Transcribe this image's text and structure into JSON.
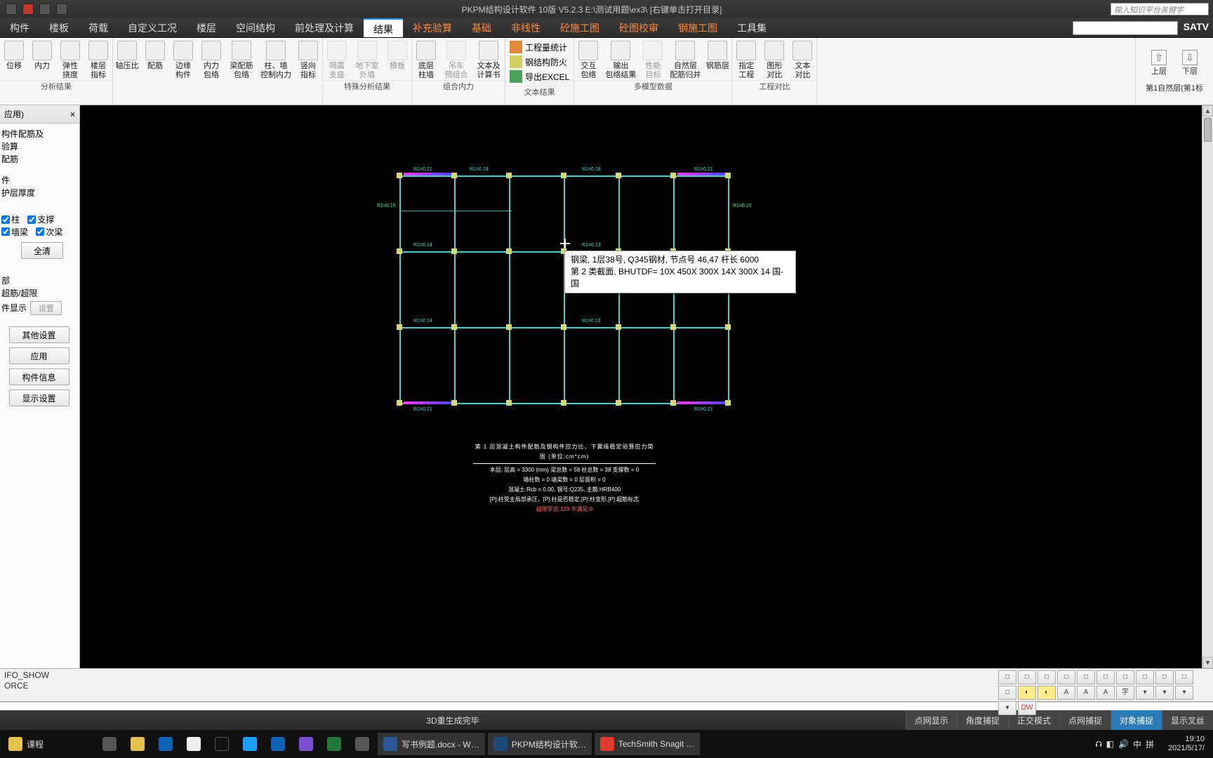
{
  "title": "PKPM结构设计软件 10版 V5.2.3 E:\\测试用题\\ex3\\   [右键单击打开目录]",
  "search_placeholder": "输入知识平台关键字",
  "menu": {
    "items": [
      "构件",
      "楼板",
      "荷载",
      "自定义工况",
      "楼层",
      "空间结构",
      "前处理及计算",
      "结果",
      "补充验算",
      "基础",
      "非线性",
      "砼施工图",
      "砼图校审",
      "钢施工图",
      "工具集"
    ],
    "active": 7,
    "dropdown": "",
    "satv": "SATV"
  },
  "ribbon": {
    "groups": [
      {
        "label": "分析结果",
        "btns": [
          {
            "l": "位移"
          },
          {
            "l": "内力"
          },
          {
            "l": "弹性\n挠度"
          },
          {
            "l": "楼层\n指标"
          }
        ]
      },
      {
        "label": "",
        "btns": [
          {
            "l": "轴压比"
          },
          {
            "l": "配筋"
          },
          {
            "l": "边缘\n构件"
          },
          {
            "l": "内力\n包络"
          },
          {
            "l": "梁配筋\n包络"
          },
          {
            "l": "柱、墙\n控制内力"
          },
          {
            "l": "竖向\n指标"
          }
        ]
      },
      {
        "label": "特殊分析结果",
        "btns": [
          {
            "l": "隔震\n支座",
            "d": true
          },
          {
            "l": "地下室\n外墙",
            "d": true
          },
          {
            "l": "模板",
            "d": true
          }
        ]
      },
      {
        "label": "组合内力",
        "btns": [
          {
            "l": "底层\n柱墙"
          },
          {
            "l": "吊车\n预组合",
            "d": true
          },
          {
            "l": "文本及\n计算书"
          }
        ]
      },
      {
        "label": "文本结果",
        "btns": [
          {
            "l": "工程量统计",
            "icon": "doc-icon"
          },
          {
            "l": "钢结构防火",
            "icon": "shield-icon"
          },
          {
            "l": "导出EXCEL",
            "icon": "export-icon"
          }
        ]
      },
      {
        "label": "多模型数据",
        "btns": [
          {
            "l": "交互\n包络"
          },
          {
            "l": "输出\n包络结果"
          },
          {
            "l": "性能\n目标",
            "d": true
          },
          {
            "l": "自然层\n配筋归并"
          },
          {
            "l": "钢筋层"
          }
        ]
      },
      {
        "label": "工程对比",
        "btns": [
          {
            "l": "指定\n工程"
          },
          {
            "l": "图形\n对比"
          },
          {
            "l": "文本\n对比"
          }
        ]
      }
    ],
    "floor": {
      "up": "上层",
      "down": "下层",
      "label": "第1自然层(第1标"
    }
  },
  "side": {
    "title": "应用)",
    "lines": [
      "构件配筋及",
      "验算",
      "配筋",
      "",
      "件",
      "护层厚度"
    ],
    "checks": [
      {
        "l": "柱",
        "c": true
      },
      {
        "l": "支撑",
        "c": true
      },
      {
        "l": "墙梁",
        "c": true
      },
      {
        "l": "次梁",
        "c": true
      }
    ],
    "btn_clear": "全清",
    "lines2": [
      "部",
      "超筋/超限"
    ],
    "lbl_disp": "件显示",
    "btn_set": "设置",
    "btn_other": "其他设置",
    "btn_apply": "应用",
    "btn_memberinfo": "构件信息",
    "btn_dispset": "显示设置"
  },
  "tooltip": {
    "l1": "钢梁, 1层38号, Q345钢材, 节点号 46,47 杆长 6000",
    "l2": "第 2 类截面, BHUTDF=   10X 450X 300X   14X 300X   14 国-国"
  },
  "drawing_notes": {
    "title": "第 1 层混凝土构件配筋及钢构件应力比、下翼缘稳定验算应力简图 (单位:cm*cm)",
    "n1": "本层: 层高 = 3300 (mm) 梁总数 = 58 柱总数 = 38  支撑数 = 0",
    "n2": "墙柱数 = 0   墙梁数 = 0   层面积 = 0",
    "n3": "混凝土:Rcb = 0.00, 钢号:Q235, 主筋:HRB400",
    "n4": "[P]:柱受主局部承压，[P]:柱是否稳定,[P]:柱变形,[P]:超筋标志",
    "warn": "超限学员:129   不满足:0"
  },
  "cmd": {
    "l1": "IFO_SHOW",
    "l2": "ORCE"
  },
  "toolbar3d": [
    "□",
    "□",
    "□",
    "□",
    "□",
    "□",
    "□",
    "□",
    "□",
    "□",
    "□",
    "◐",
    "◐",
    "A",
    "A",
    "A",
    "字",
    "▾",
    "▾",
    "▾",
    "▾",
    "DW"
  ],
  "status": {
    "center": "3D重生成完毕",
    "segs": [
      {
        "l": "点网显示"
      },
      {
        "l": "角度捕捉"
      },
      {
        "l": "正交模式"
      },
      {
        "l": "点网捕捉"
      },
      {
        "l": "对象捕捉",
        "a": true
      },
      {
        "l": "显示叉丝"
      }
    ]
  },
  "taskbar": {
    "start": "课程",
    "items": [
      {
        "l": "",
        "i": "#333"
      },
      {
        "l": "",
        "i": "#333"
      },
      {
        "l": "",
        "i": "#0a63b5"
      },
      {
        "l": "",
        "i": "#fff"
      },
      {
        "l": "",
        "i": "#111"
      },
      {
        "l": "",
        "i": "#1a9fff"
      },
      {
        "l": "",
        "i": "#0a63b5"
      },
      {
        "l": "",
        "i": "#7a4fd1"
      },
      {
        "l": "",
        "i": "#1f7a3a"
      },
      {
        "l": "",
        "i": "#555"
      },
      {
        "l": "写书例题.docx - W…",
        "i": "#2b579a"
      },
      {
        "l": "PKPM结构设计软…",
        "i": "#1e4b7b",
        "a": true
      },
      {
        "l": "TechSmith Snagit …",
        "i": "#e23b2e"
      }
    ],
    "tray": [
      "⮉",
      "◧",
      "🔊",
      "中",
      "拼"
    ],
    "time": "19:10",
    "date": "2021/5/17/"
  }
}
